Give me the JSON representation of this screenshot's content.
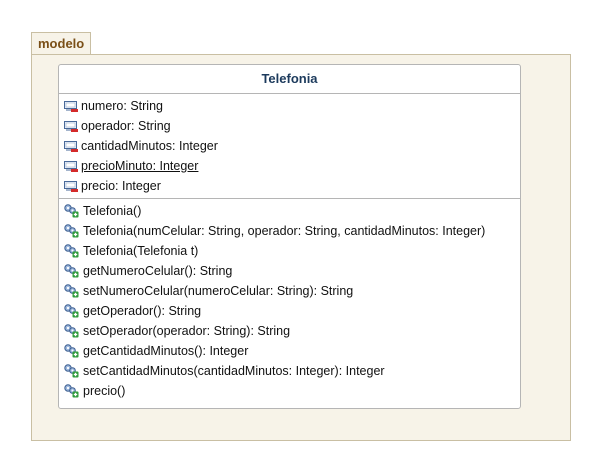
{
  "package": {
    "name": "modelo"
  },
  "class": {
    "name": "Telefonia",
    "attributes": [
      {
        "text": "numero: String",
        "icon": "private-field-icon",
        "static": false
      },
      {
        "text": "operador: String",
        "icon": "private-field-icon",
        "static": false
      },
      {
        "text": "cantidadMinutos: Integer",
        "icon": "private-field-icon",
        "static": false
      },
      {
        "text": "precioMinuto: Integer",
        "icon": "private-field-icon",
        "static": true
      },
      {
        "text": "precio: Integer",
        "icon": "private-field-icon",
        "static": false
      }
    ],
    "operations": [
      {
        "text": "Telefonia()",
        "icon": "public-method-icon"
      },
      {
        "text": "Telefonia(numCelular: String, operador: String, cantidadMinutos: Integer)",
        "icon": "public-method-icon"
      },
      {
        "text": "Telefonia(Telefonia t)",
        "icon": "public-method-icon"
      },
      {
        "text": "getNumeroCelular(): String",
        "icon": "public-method-icon"
      },
      {
        "text": "setNumeroCelular(numeroCelular: String): String",
        "icon": "public-method-icon"
      },
      {
        "text": "getOperador(): String",
        "icon": "public-method-icon"
      },
      {
        "text": "setOperador(operador: String): String",
        "icon": "public-method-icon"
      },
      {
        "text": "getCantidadMinutos(): Integer",
        "icon": "public-method-icon"
      },
      {
        "text": "setCantidadMinutos(cantidadMinutos: Integer): Integer",
        "icon": "public-method-icon"
      },
      {
        "text": "precio()",
        "icon": "public-method-icon"
      }
    ]
  },
  "colors": {
    "package_fill": "#f7f3e8",
    "package_border": "#c9bfa3",
    "package_label": "#7a4f17",
    "class_title": "#1c3a5c",
    "private_marker": "#d42a2a",
    "public_marker": "#2e9b3a"
  }
}
